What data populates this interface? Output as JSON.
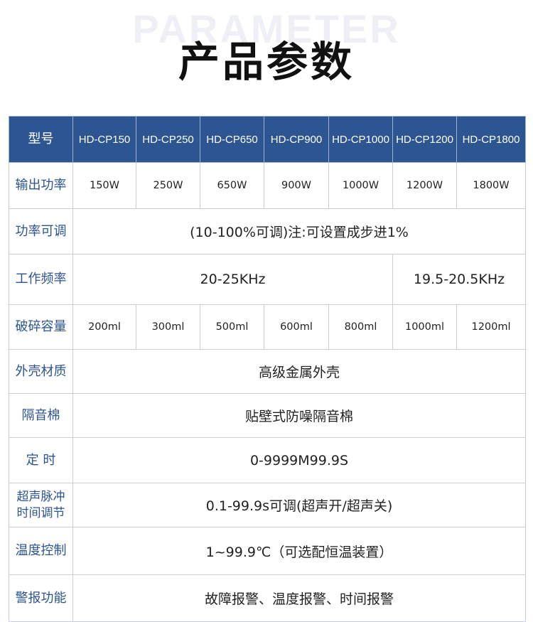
{
  "header": {
    "watermark": "PARAMETER",
    "title": "产品参数"
  },
  "table": {
    "model_label": "型号",
    "models": [
      "HD-CP150",
      "HD-CP250",
      "HD-CP650",
      "HD-CP900",
      "HD-CP1000",
      "HD-CP1200",
      "HD-CP1800"
    ],
    "power": {
      "label": "输出功率",
      "values": [
        "150W",
        "250W",
        "650W",
        "900W",
        "1000W",
        "1200W",
        "1800W"
      ]
    },
    "adjust": {
      "label": "功率可调",
      "value": "(10-100%可调)注:可设置成步进1%"
    },
    "freq": {
      "label": "工作频率",
      "value_a": "20-25KHz",
      "value_b": "19.5-20.5KHz"
    },
    "capacity": {
      "label": "破碎容量",
      "values": [
        "200ml",
        "300ml",
        "500ml",
        "600ml",
        "800ml",
        "1000ml",
        "1200ml"
      ]
    },
    "shell": {
      "label": "外壳材质",
      "value": "高级金属外壳"
    },
    "sound": {
      "label": "隔音棉",
      "value": "贴壁式防噪隔音棉"
    },
    "timer": {
      "label": "定 时",
      "value": "0-9999M99.9S"
    },
    "pulse": {
      "label_line1": "超声脉冲",
      "label_line2": "时间调节",
      "value": "0.1-99.9s可调(超声开/超声关)"
    },
    "temp": {
      "label": "温度控制",
      "value": "1~99.9℃（可选配恒温装置）"
    },
    "alarm": {
      "label": "警报功能",
      "value": "故障报警、温度报警、时间报警"
    }
  }
}
